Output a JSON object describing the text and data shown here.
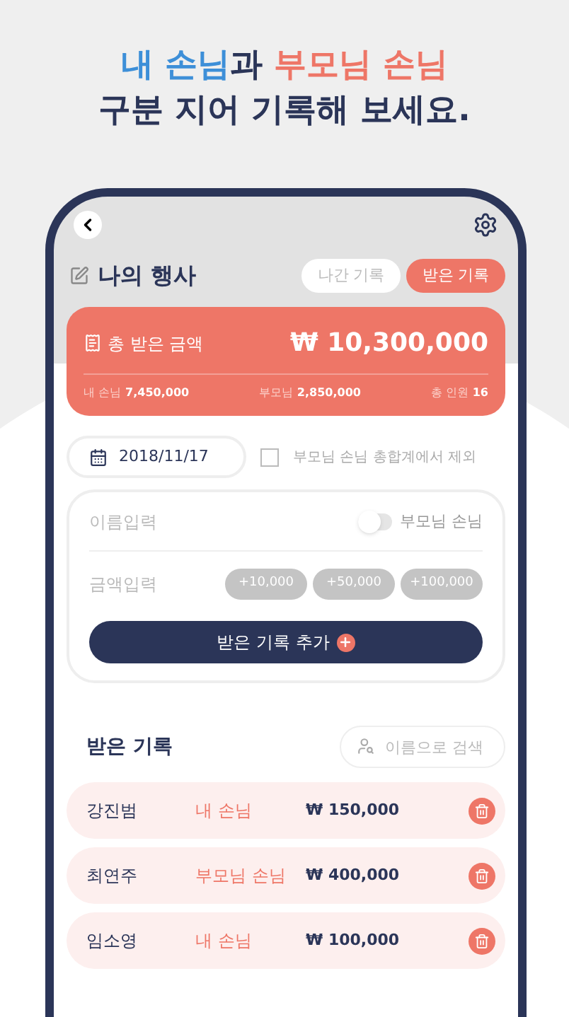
{
  "headline": {
    "line1": [
      {
        "text": "내 손님",
        "kind": "mine"
      },
      {
        "text": "과 ",
        "kind": "plain"
      },
      {
        "text": "부모님 손님",
        "kind": "parent"
      }
    ],
    "line2": "구분 지어 기록해 보세요."
  },
  "screen": {
    "title": "나의 행사",
    "tabs": [
      {
        "label": "나간 기록",
        "selected": false
      },
      {
        "label": "받은 기록",
        "selected": true
      }
    ],
    "summary": {
      "label": "총 받은 금액",
      "total": "₩ 10,300,000",
      "stats": [
        {
          "label": "내 손님",
          "value": "7,450,000"
        },
        {
          "label": "부모님",
          "value": "2,850,000"
        },
        {
          "label": "총 인원",
          "value": "16"
        }
      ]
    },
    "date": "2018/11/17",
    "exclude_parents": {
      "label": "부모님 손님 총합계에서 제외",
      "checked": false
    },
    "form": {
      "name_placeholder": "이름입력",
      "parent_toggle": {
        "label": "부모님 손님",
        "on": false
      },
      "amount_placeholder": "금액입력",
      "quick_amounts": [
        "+10,000",
        "+50,000",
        "+100,000"
      ],
      "submit": "받은 기록 추가"
    },
    "records_title": "받은 기록",
    "search": {
      "placeholder": "이름으로 검색"
    },
    "records": [
      {
        "name": "강진범",
        "type": "내 손님",
        "amount": "₩ 150,000"
      },
      {
        "name": "최연주",
        "type": "부모님 손님",
        "amount": "₩ 400,000"
      },
      {
        "name": "임소영",
        "type": "내 손님",
        "amount": "₩ 100,000"
      }
    ]
  }
}
